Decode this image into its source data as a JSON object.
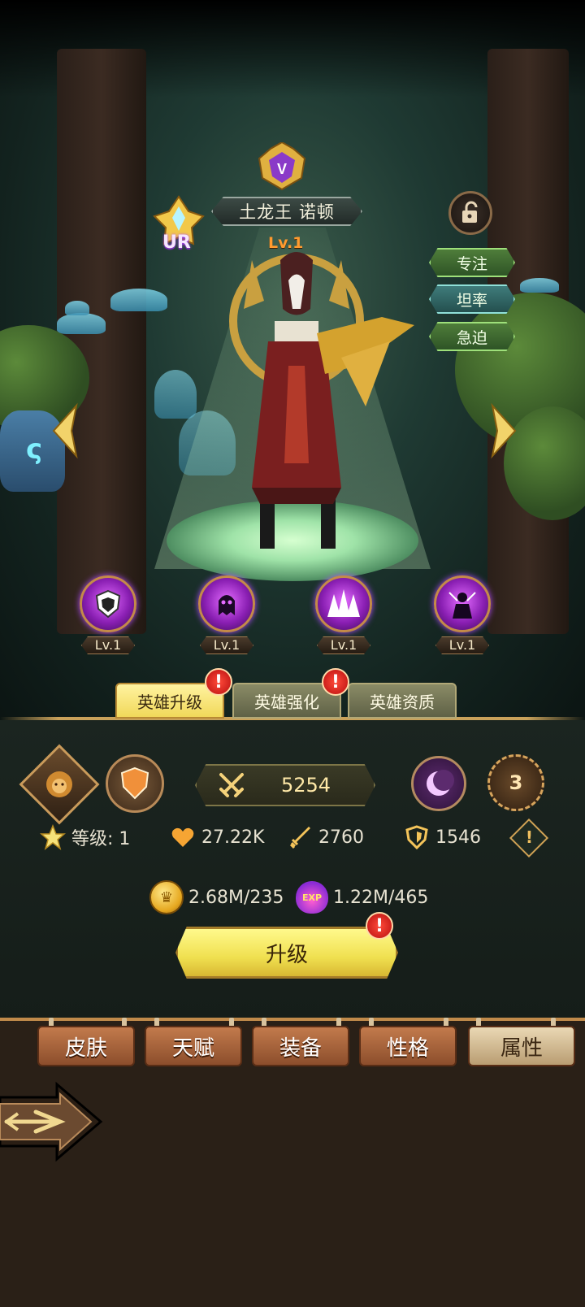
{
  "hero": {
    "name": "土龙王 诺顿",
    "rarity": "UR",
    "level_label": "Lv.1",
    "rank_letter": "V"
  },
  "traits": [
    "专注",
    "坦率",
    "急迫"
  ],
  "skills": [
    {
      "icon": "shield-skill-icon",
      "level": "Lv.1"
    },
    {
      "icon": "ghost-skill-icon",
      "level": "Lv.1"
    },
    {
      "icon": "burst-skill-icon",
      "level": "Lv.1"
    },
    {
      "icon": "shadow-skill-icon",
      "level": "Lv.1"
    }
  ],
  "tabs": [
    {
      "label": "英雄升级",
      "active": true,
      "alert": "!"
    },
    {
      "label": "英雄强化",
      "active": false,
      "alert": "!"
    },
    {
      "label": "英雄资质",
      "active": false
    }
  ],
  "power": "5254",
  "star_count": "3",
  "stats": {
    "level": "等级: 1",
    "hp": "27.22K",
    "attack": "2760",
    "defense": "1546"
  },
  "costs": {
    "gold": "2.68M/235",
    "exp_icon": "EXP",
    "exp": "1.22M/465"
  },
  "upgrade": {
    "label": "升级",
    "alert": "!"
  },
  "info_mark": "!",
  "menu": [
    {
      "label": "皮肤",
      "active": false
    },
    {
      "label": "天赋",
      "active": false
    },
    {
      "label": "装备",
      "active": false
    },
    {
      "label": "性格",
      "active": false
    },
    {
      "label": "属性",
      "active": true
    }
  ],
  "colors": {
    "accent_gold": "#f0e050",
    "alert_red": "#d81b1b",
    "level_orange": "#ff9a2e",
    "skill_purple": "#8a1fb3"
  }
}
